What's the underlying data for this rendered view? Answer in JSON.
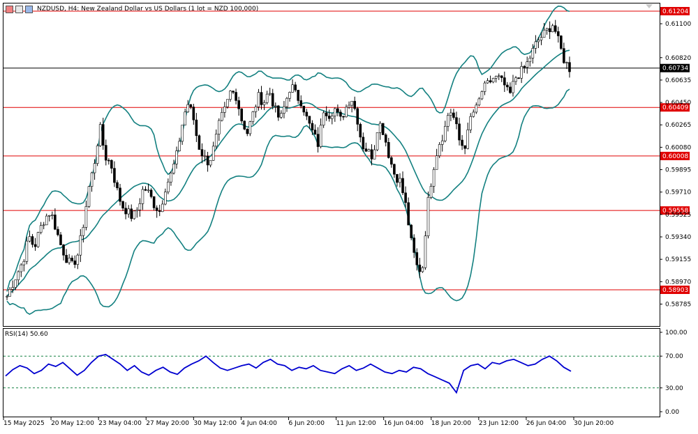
{
  "header": {
    "title": "NZDUSD, H4:  New Zealand Dollar vs US Dollars (1 lot = NZD 100,000)"
  },
  "indicator": {
    "label": "RSI(14) 50.60"
  },
  "chart_data": [
    {
      "type": "candlestick",
      "title": "NZDUSD, H4:  New Zealand Dollar vs US Dollars (1 lot = NZD 100,000)",
      "symbol": "NZDUSD",
      "timeframe": "H4",
      "ylim": [
        0.587,
        0.6131
      ],
      "y_ticks": [
        "0.61100",
        "0.60820",
        "0.60635",
        "0.60450",
        "0.60265",
        "0.60080",
        "0.59895",
        "0.59710",
        "0.59525",
        "0.59340",
        "0.59155",
        "0.58970",
        "0.58785"
      ],
      "x_ticks": [
        "15 May 2025",
        "20 May 12:00",
        "23 May 04:00",
        "27 May 20:00",
        "30 May 12:00",
        "4 Jun 04:00",
        "6 Jun 20:00",
        "11 Jun 12:00",
        "16 Jun 04:00",
        "18 Jun 20:00",
        "23 Jun 12:00",
        "26 Jun 04:00",
        "30 Jun 20:00"
      ],
      "current_price": "0.60734",
      "horizontal_levels": [
        {
          "price": 0.61204,
          "label": "0.61204"
        },
        {
          "price": 0.60409,
          "label": "0.60409"
        },
        {
          "price": 0.60008,
          "label": "0.60008"
        },
        {
          "price": 0.59558,
          "label": "0.59558"
        },
        {
          "price": 0.58903,
          "label": "0.58903"
        }
      ],
      "close_path": [
        [
          0.5885,
          0.5895
        ],
        [
          0.5905,
          0.5915
        ],
        [
          0.5935,
          0.5925
        ],
        [
          0.594,
          0.595
        ],
        [
          0.5955,
          0.594
        ],
        [
          0.5925,
          0.5915
        ],
        [
          0.591,
          0.592
        ],
        [
          0.5945,
          0.5975
        ],
        [
          0.5995,
          0.6025
        ],
        [
          0.6,
          0.5995
        ],
        [
          0.5975,
          0.596
        ],
        [
          0.5955,
          0.595
        ],
        [
          0.5958,
          0.5975
        ],
        [
          0.597,
          0.596
        ],
        [
          0.5955,
          0.5975
        ],
        [
          0.5985,
          0.6
        ],
        [
          0.6025,
          0.6045
        ],
        [
          0.6035,
          0.601
        ],
        [
          0.6,
          0.5995
        ],
        [
          0.601,
          0.603
        ],
        [
          0.604,
          0.6055
        ],
        [
          0.605,
          0.603
        ],
        [
          0.602,
          0.6035
        ],
        [
          0.605,
          0.6045
        ],
        [
          0.6055,
          0.604
        ],
        [
          0.603,
          0.6045
        ],
        [
          0.606,
          0.605
        ],
        [
          0.6045,
          0.603
        ],
        [
          0.602,
          0.601
        ],
        [
          0.604,
          0.6035
        ],
        [
          0.604,
          0.603
        ],
        [
          0.604,
          0.605
        ],
        [
          0.6035,
          0.601
        ],
        [
          0.6005,
          0.6
        ],
        [
          0.603,
          0.602
        ],
        [
          0.6,
          0.5985
        ],
        [
          0.598,
          0.596
        ],
        [
          0.593,
          0.591
        ],
        [
          0.5905,
          0.596
        ],
        [
          0.599,
          0.601
        ],
        [
          0.602,
          0.604
        ],
        [
          0.603,
          0.601
        ],
        [
          0.601,
          0.6035
        ],
        [
          0.604,
          0.6055
        ],
        [
          0.606,
          0.6065
        ],
        [
          0.6065,
          0.606
        ],
        [
          0.605,
          0.6065
        ],
        [
          0.607,
          0.6075
        ],
        [
          0.6085,
          0.6095
        ],
        [
          0.61,
          0.6105
        ],
        [
          0.611,
          0.6095
        ],
        [
          0.608,
          0.6073
        ]
      ],
      "bollinger_bands": {
        "period": 20
      },
      "series": [
        {
          "name": "RSI(14)",
          "last": 50.6
        }
      ]
    },
    {
      "type": "line",
      "title": "RSI(14) 50.60",
      "ylim": [
        0,
        100
      ],
      "y_ticks": [
        "100.00",
        "70.00",
        "30.00",
        "0.00"
      ],
      "levels": [
        70,
        30
      ],
      "values": [
        45,
        53,
        58,
        55,
        48,
        52,
        60,
        57,
        62,
        54,
        46,
        52,
        62,
        70,
        72,
        66,
        60,
        52,
        58,
        50,
        46,
        52,
        56,
        50,
        47,
        55,
        60,
        64,
        70,
        62,
        55,
        52,
        55,
        58,
        60,
        55,
        62,
        66,
        60,
        58,
        52,
        56,
        54,
        58,
        52,
        50,
        48,
        54,
        58,
        52,
        55,
        60,
        55,
        50,
        48,
        52,
        50,
        56,
        54,
        48,
        44,
        40,
        36,
        24,
        52,
        58,
        60,
        54,
        62,
        60,
        64,
        66,
        62,
        58,
        60,
        66,
        70,
        64,
        56,
        51
      ]
    }
  ]
}
